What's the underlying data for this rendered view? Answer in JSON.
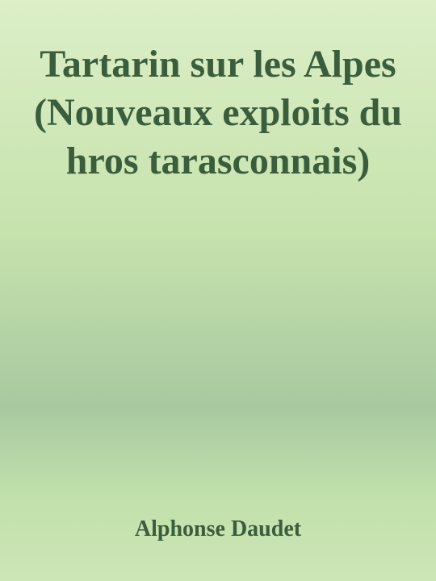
{
  "cover": {
    "title": "Tartarin sur les Alpes (Nouveaux exploits du hros tarasconnais)",
    "author": "Alphonse Daudet"
  }
}
